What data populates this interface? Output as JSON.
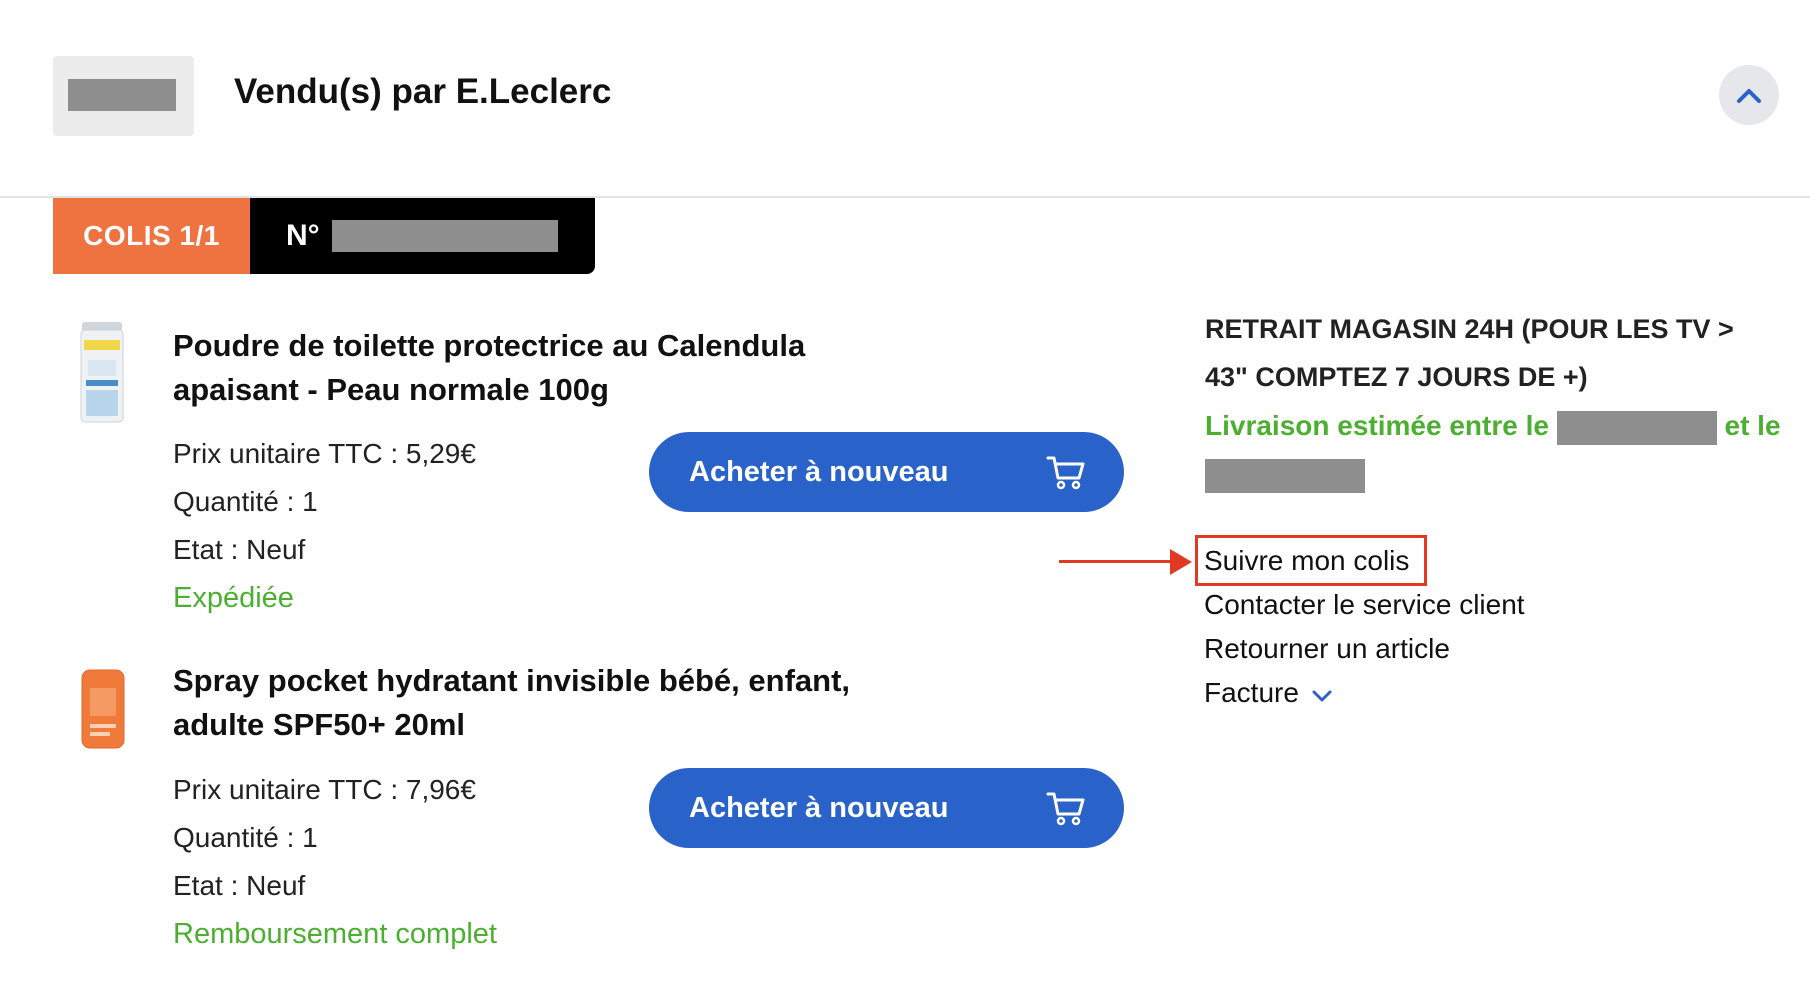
{
  "header": {
    "seller_title": "Vendu(s) par E.Leclerc",
    "collapse_icon": "chevron-up-icon"
  },
  "colis": {
    "label": "COLIS 1/1",
    "number_prefix": "N°"
  },
  "products": [
    {
      "title_line1": "Poudre de toilette protectrice au Calendula",
      "title_line2": "apaisant - Peau normale 100g",
      "price": "Prix unitaire TTC : 5,29€",
      "quantity": "Quantité : 1",
      "state": "Etat : Neuf",
      "status": "Expédiée",
      "buy_again_label": "Acheter à nouveau"
    },
    {
      "title_line1": "Spray pocket hydratant invisible bébé, enfant,",
      "title_line2": "adulte SPF50+ 20ml",
      "price": "Prix unitaire TTC : 7,96€",
      "quantity": "Quantité : 1",
      "state": "Etat : Neuf",
      "status": "Remboursement complet",
      "buy_again_label": "Acheter à nouveau"
    }
  ],
  "delivery": {
    "mode_line1": "RETRAIT MAGASIN 24H (POUR LES TV >",
    "mode_line2": "43\" COMPTEZ 7 JOURS DE +)",
    "estimate_prefix": "Livraison estimée entre le",
    "estimate_middle": "et le"
  },
  "actions": {
    "track": "Suivre mon colis",
    "contact": "Contacter le service client",
    "return": "Retourner un article",
    "invoice": "Facture"
  },
  "colors": {
    "accent_blue": "#2962c9",
    "colis_orange": "#ef7340",
    "status_green": "#4caf32",
    "highlight_red": "#e03a25"
  }
}
